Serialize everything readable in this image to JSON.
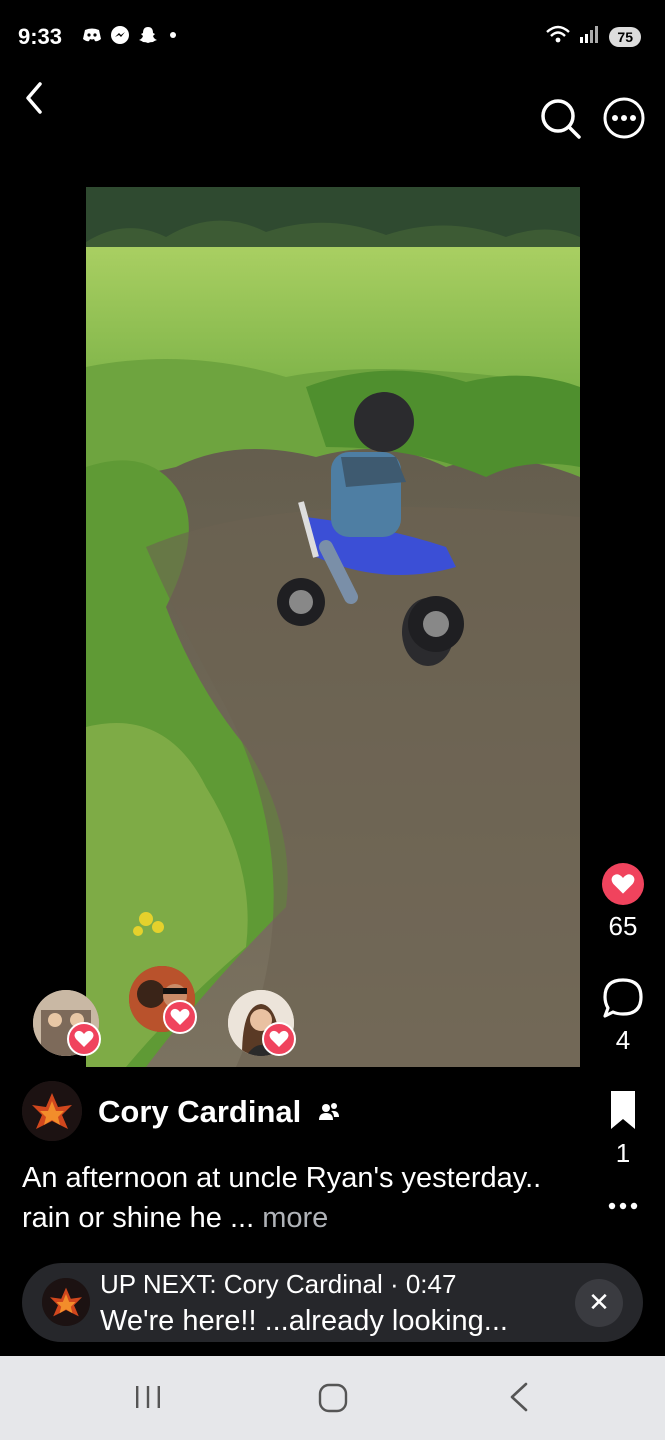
{
  "status": {
    "time": "9:33",
    "battery": "75",
    "left_icons": [
      "discord-icon",
      "messenger-icon",
      "snapchat-icon"
    ]
  },
  "post": {
    "author": "Cory Cardinal",
    "caption": "An afternoon at uncle Ryan's yesterday.. rain or shine he ...",
    "more_label": "more",
    "likes": "65",
    "comments": "4",
    "saves": "1"
  },
  "up_next": {
    "line1": "UP NEXT: Cory Cardinal · 0:47",
    "line2": "We're here!! ...already looking..."
  },
  "colors": {
    "like": "#f0435d",
    "background": "#000000",
    "up_next_bg": "#26272b",
    "nav_bar": "#e6e7ea"
  }
}
